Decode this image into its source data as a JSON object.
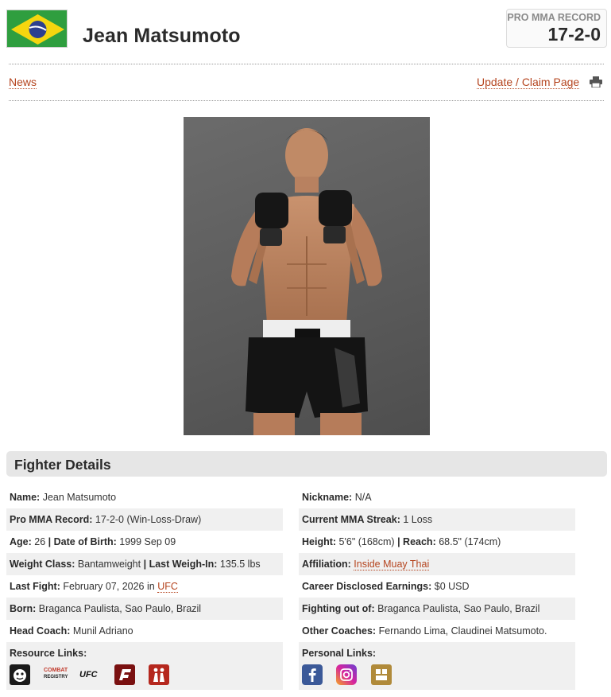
{
  "fighter": {
    "name": "Jean Matsumoto",
    "record_label": "PRO MMA RECORD",
    "record": "17-2-0"
  },
  "nav": {
    "news": "News",
    "update": "Update / Claim Page"
  },
  "section_title": "Fighter Details",
  "details": {
    "name_label": "Name:",
    "name_value": " Jean Matsumoto",
    "nickname_label": "Nickname:",
    "nickname_value": " N/A",
    "record_label": "Pro MMA Record:",
    "record_value": " 17-2-0 (Win-Loss-Draw)",
    "streak_label": "Current MMA Streak:",
    "streak_value": " 1 Loss",
    "age_label": "Age:",
    "age_value": " 26",
    "sep": " | ",
    "dob_label": "Date of Birth:",
    "dob_value": " 1999 Sep 09",
    "height_label": "Height:",
    "height_value": " 5'6\" (168cm)",
    "reach_label": "Reach:",
    "reach_value": " 68.5\" (174cm)",
    "weightclass_label": "Weight Class:",
    "weightclass_value": " Bantamweight",
    "weighin_label": "Last Weigh-In:",
    "weighin_value": " 135.5 lbs",
    "affiliation_label": "Affiliation:",
    "affiliation_value": "Inside Muay Thai",
    "lastfight_label": "Last Fight:",
    "lastfight_value": " February 07, 2026 in ",
    "lastfight_org": "UFC",
    "earnings_label": "Career Disclosed Earnings:",
    "earnings_value": " $0 USD",
    "born_label": "Born:",
    "born_value": " Braganca Paulista, Sao Paulo, Brazil",
    "fightingout_label": "Fighting out of:",
    "fightingout_value": " Braganca Paulista, Sao Paulo, Brazil",
    "headcoach_label": "Head Coach:",
    "headcoach_value": " Munil Adriano",
    "othercoaches_label": "Other Coaches:",
    "othercoaches_value": " Fernando Lima, Claudinei Matsumoto.",
    "resource_links_label": "Resource Links:",
    "personal_links_label": "Personal Links:"
  },
  "resource_icons": {
    "combat_line1": "COMBAT",
    "combat_line2": "REGISTRY",
    "ufc": "UFC"
  },
  "colors": {
    "accent": "#b5441e",
    "flag_green": "#2f9e3f",
    "flag_yellow": "#f5d60f",
    "flag_blue": "#2c3f8f",
    "facebook": "#3b5998",
    "instagram": "#c13584",
    "tapology": "#b08a3a"
  }
}
